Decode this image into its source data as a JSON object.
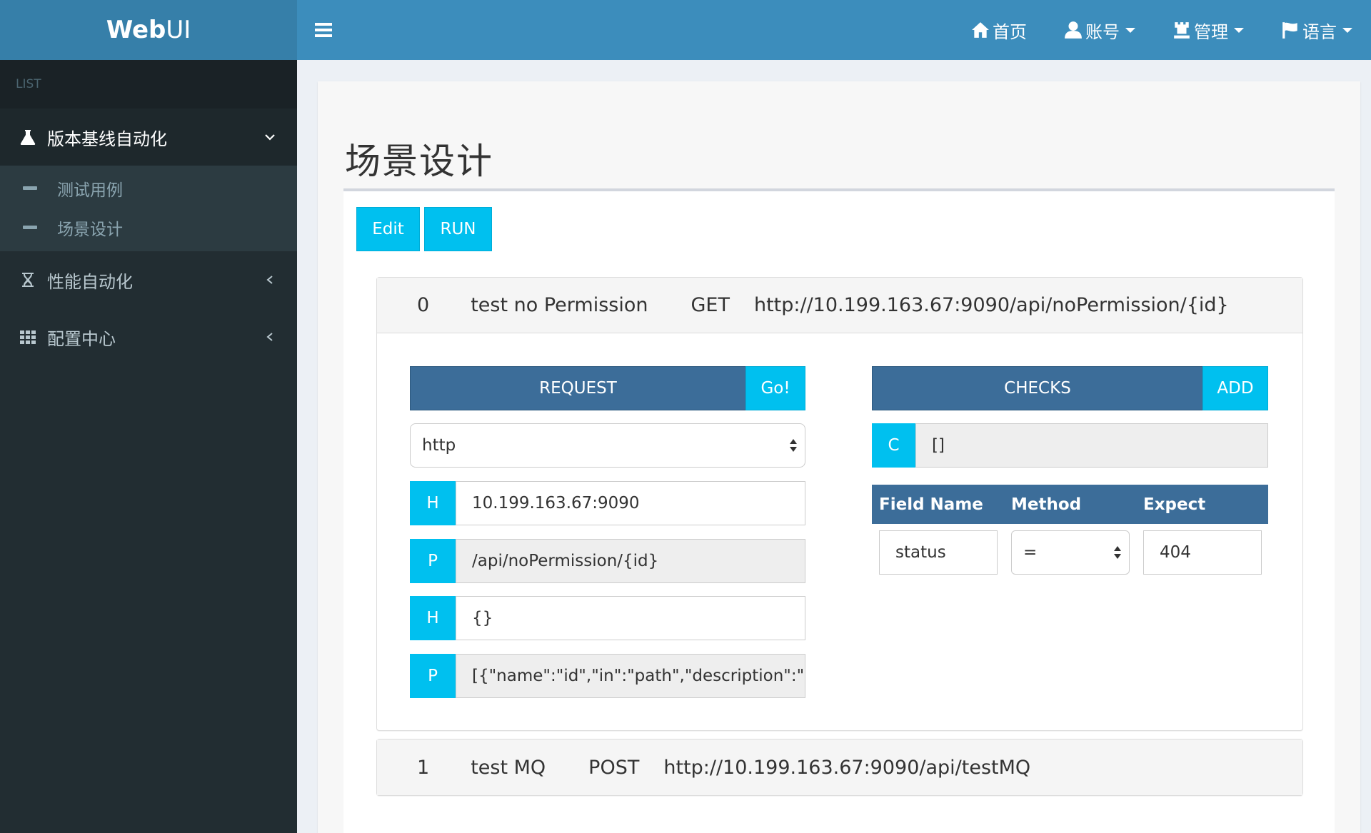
{
  "header": {
    "logo_bold": "Web",
    "logo_light": "UI",
    "nav": [
      {
        "label": "首页",
        "icon": "home-icon",
        "dropdown": false
      },
      {
        "label": "账号",
        "icon": "user-icon",
        "dropdown": true
      },
      {
        "label": "管理",
        "icon": "tower-icon",
        "dropdown": true
      },
      {
        "label": "语言",
        "icon": "flag-icon",
        "dropdown": true
      }
    ]
  },
  "sidebar": {
    "header": "LIST",
    "groups": [
      {
        "label": "版本基线自动化",
        "icon": "flask-icon",
        "expanded": true,
        "items": [
          {
            "label": "测试用例"
          },
          {
            "label": "场景设计"
          }
        ]
      },
      {
        "label": "性能自动化",
        "icon": "hourglass-icon",
        "expanded": false
      },
      {
        "label": "配置中心",
        "icon": "grid-icon",
        "expanded": false
      }
    ]
  },
  "main": {
    "title": "场景设计",
    "buttons": {
      "edit": "Edit",
      "run": "RUN"
    },
    "cases": [
      {
        "index": "0",
        "name": "test no Permission",
        "method": "GET",
        "url": "http://10.199.163.67:9090/api/noPermission/{id}",
        "request": {
          "bar_label": "REQUEST",
          "go_label": "Go!",
          "protocol": "http",
          "rows": [
            {
              "addon": "H",
              "value": "10.199.163.67:9090",
              "readonly": false
            },
            {
              "addon": "P",
              "value": "/api/noPermission/{id}",
              "readonly": true
            },
            {
              "addon": "H",
              "value": "{}",
              "readonly": false
            },
            {
              "addon": "P",
              "value": "[{\"name\":\"id\",\"in\":\"path\",\"description\":\"ID",
              "readonly": true
            }
          ]
        },
        "checks": {
          "bar_label": "CHECKS",
          "add_label": "ADD",
          "c_addon": "C",
          "c_value": "[]",
          "columns": [
            "Field Name",
            "Method",
            "Expect"
          ],
          "rows": [
            {
              "field": "status",
              "method": "=",
              "expect": "404"
            }
          ]
        }
      },
      {
        "index": "1",
        "name": "test MQ",
        "method": "POST",
        "url": "http://10.199.163.67:9090/api/testMQ"
      }
    ]
  },
  "colors": {
    "header": "#3c8dbc",
    "logo": "#367fa9",
    "sidebar": "#222d32",
    "accent": "#00c0ef",
    "bar": "#3c6d99"
  }
}
